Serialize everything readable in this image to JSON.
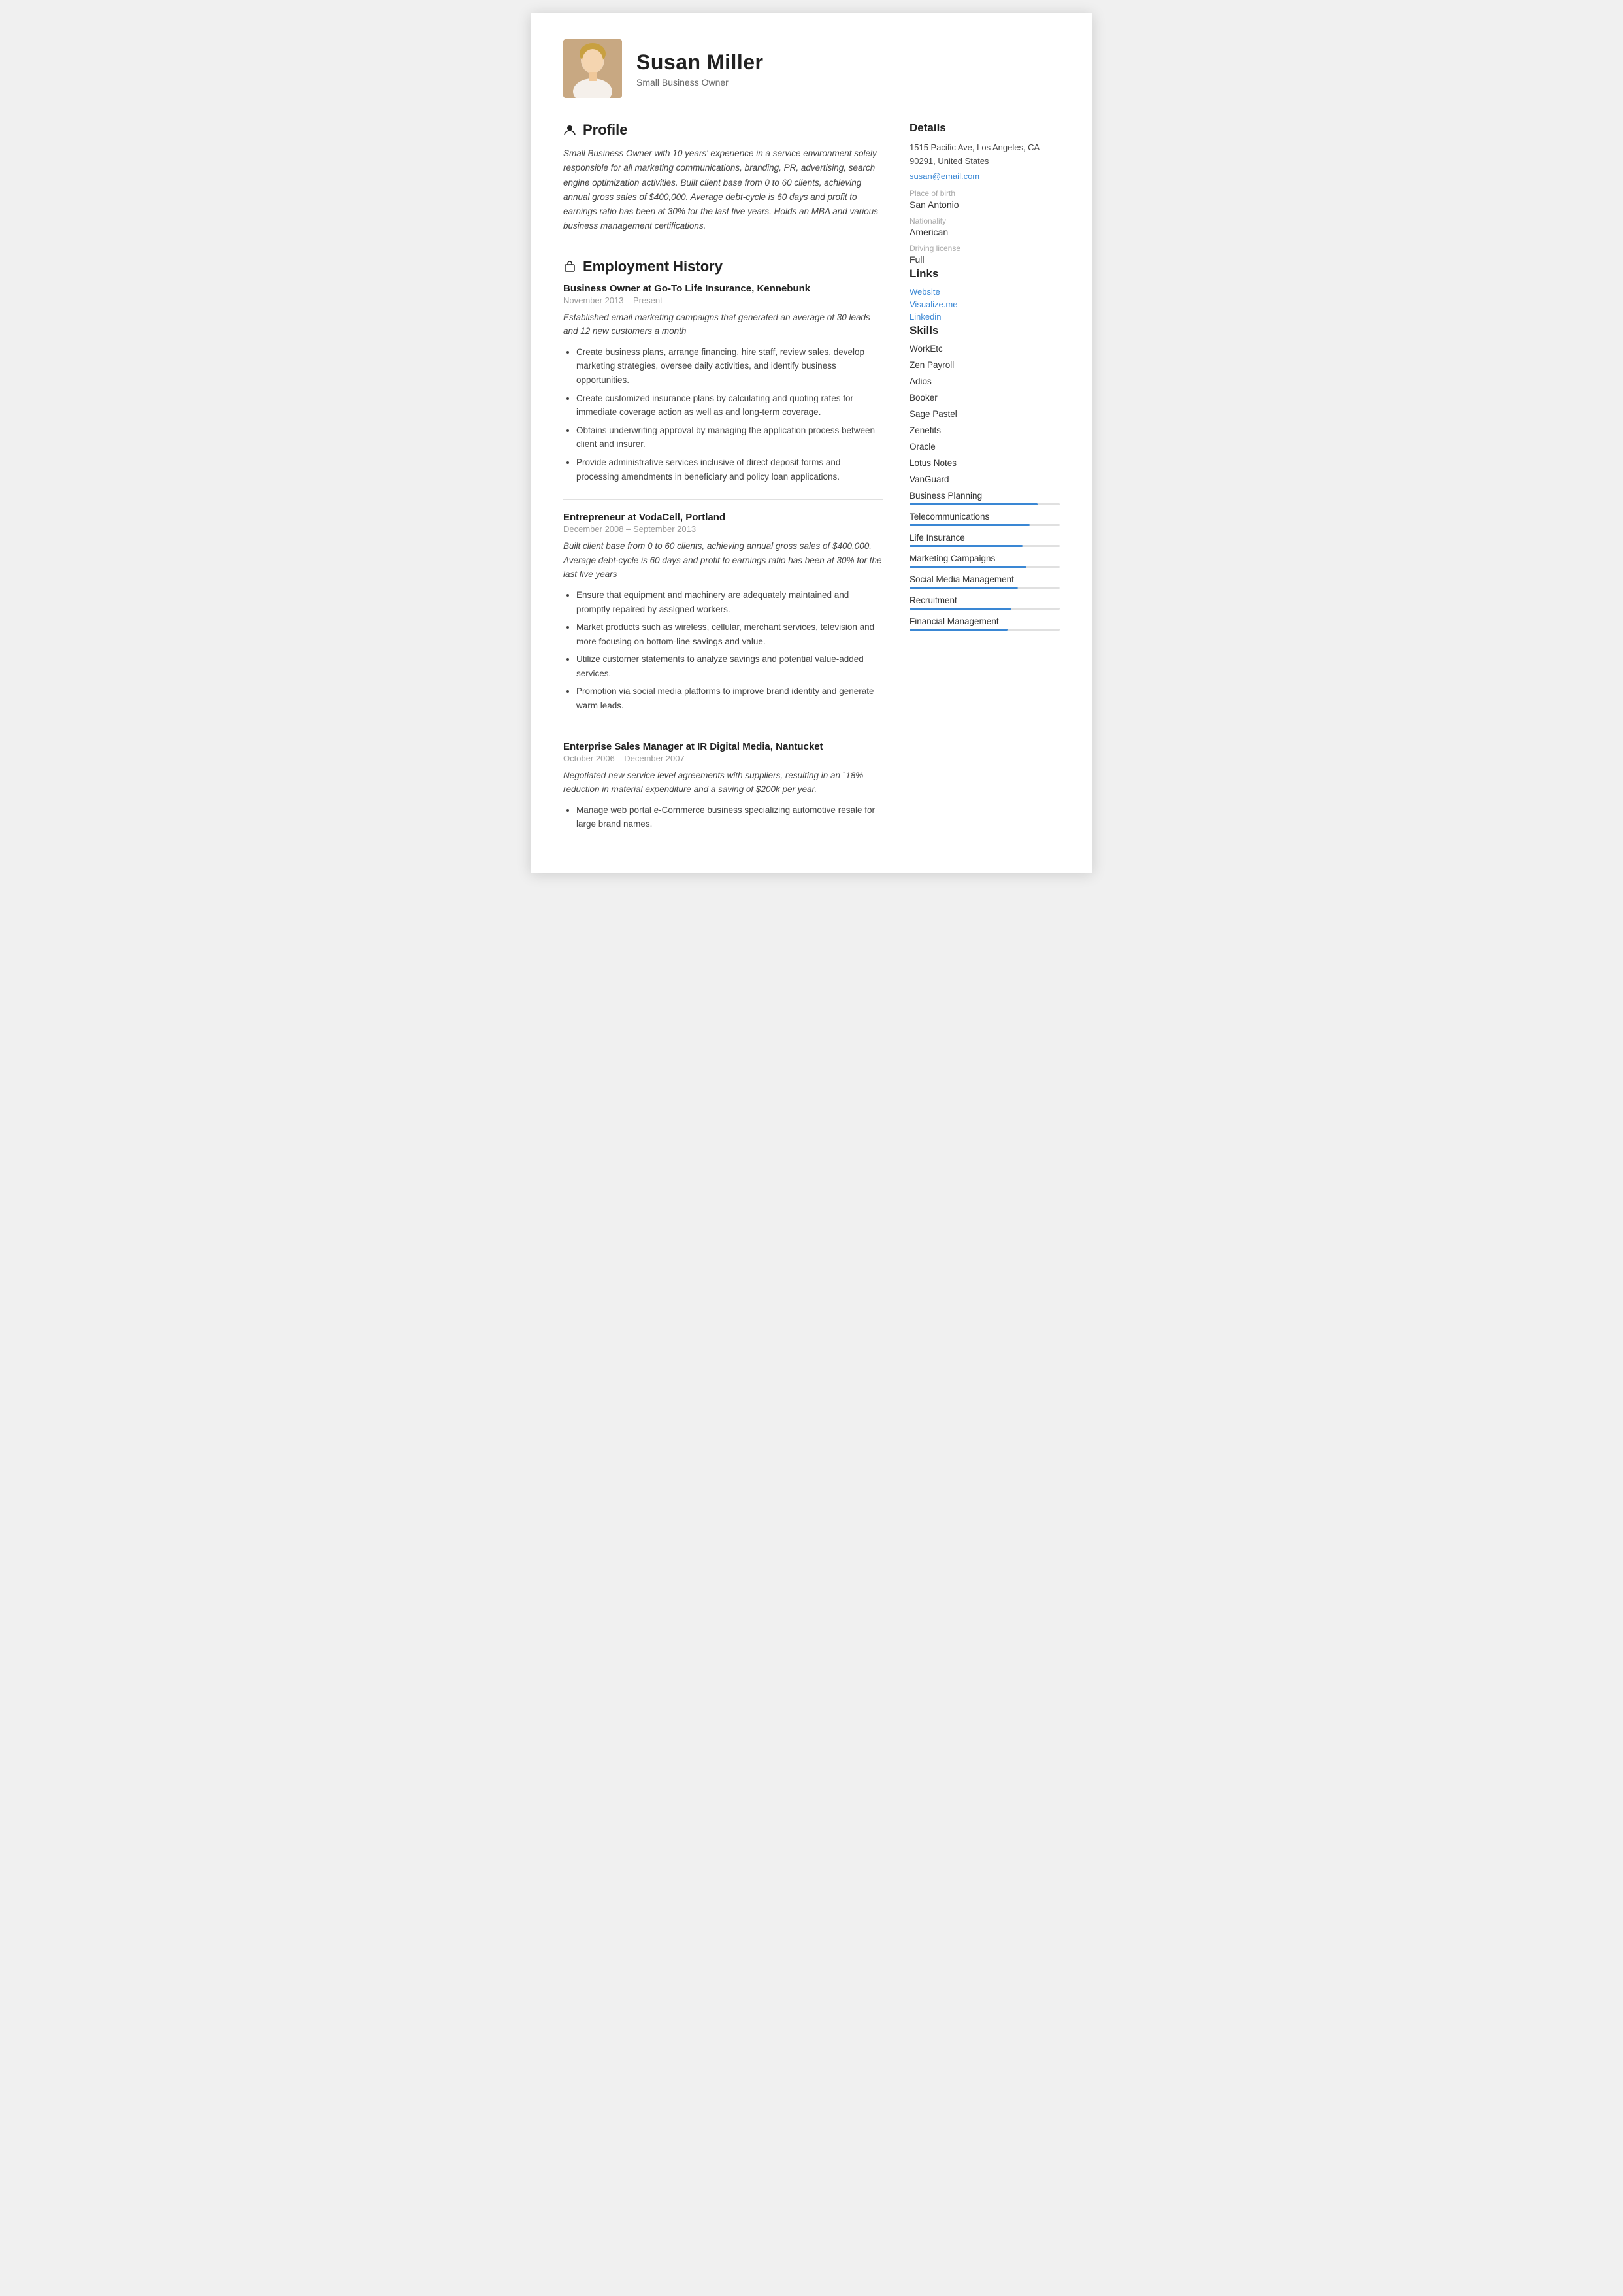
{
  "header": {
    "name": "Susan Miller",
    "subtitle": "Small Business Owner",
    "avatar_alt": "Susan Miller photo"
  },
  "profile": {
    "section_label": "Profile",
    "text": "Small Business Owner with 10 years' experience in a service environment solely responsible for all marketing communications, branding, PR, advertising, search engine optimization activities. Built client base from 0 to 60 clients, achieving annual gross sales of $400,000. Average debt-cycle is 60 days and profit to earnings ratio has been at 30% for the last five years. Holds an MBA and various business management certifications."
  },
  "employment": {
    "section_label": "Employment History",
    "jobs": [
      {
        "title": "Business Owner at Go-To Life Insurance, Kennebunk",
        "dates": "November 2013 – Present",
        "summary": "Established email marketing campaigns that generated an average of 30 leads and 12 new customers a month",
        "bullets": [
          "Create business plans, arrange financing, hire staff, review sales, develop marketing strategies, oversee daily activities, and identify business opportunities.",
          "Create customized insurance plans by calculating and quoting rates for immediate coverage action as well as and long-term coverage.",
          "Obtains underwriting approval by managing the application process between client and insurer.",
          "Provide administrative services inclusive of direct deposit forms and processing amendments in beneficiary and policy loan applications."
        ]
      },
      {
        "title": "Entrepreneur at VodaCell, Portland",
        "dates": "December 2008 – September 2013",
        "summary": "Built client base from 0 to 60 clients, achieving annual gross sales of $400,000. Average debt-cycle is 60 days and profit to earnings ratio has been at 30% for the last five years",
        "bullets": [
          "Ensure that equipment and machinery are adequately maintained and promptly repaired by assigned workers.",
          "Market products such as wireless, cellular, merchant services, television and more focusing on bottom-line savings and value.",
          "Utilize customer statements to analyze savings and potential value-added services.",
          "Promotion via social media platforms to improve brand identity and generate warm leads."
        ]
      },
      {
        "title": "Enterprise Sales Manager at IR Digital Media, Nantucket",
        "dates": "October 2006 – December 2007",
        "summary": "Negotiated new service level agreements with suppliers, resulting in an `18% reduction in material expenditure and a saving of $200k per year.",
        "bullets": [
          "Manage web portal e-Commerce business specializing automotive resale for large brand names."
        ]
      }
    ]
  },
  "details": {
    "section_label": "Details",
    "address": "1515 Pacific Ave, Los Angeles, CA 90291, United States",
    "email": "susan@email.com",
    "place_of_birth_label": "Place of birth",
    "place_of_birth": "San Antonio",
    "nationality_label": "Nationality",
    "nationality": "American",
    "driving_license_label": "Driving license",
    "driving_license": "Full"
  },
  "links": {
    "section_label": "Links",
    "items": [
      {
        "label": "Website"
      },
      {
        "label": "Visualize.me"
      },
      {
        "label": "Linkedin"
      }
    ]
  },
  "skills": {
    "section_label": "Skills",
    "items": [
      {
        "name": "WorkEtc",
        "has_bar": false
      },
      {
        "name": "Zen Payroll",
        "has_bar": false
      },
      {
        "name": "Adios",
        "has_bar": false
      },
      {
        "name": "Booker",
        "has_bar": false
      },
      {
        "name": "Sage Pastel",
        "has_bar": false
      },
      {
        "name": "Zenefits",
        "has_bar": false
      },
      {
        "name": "Oracle",
        "has_bar": false
      },
      {
        "name": "Lotus Notes",
        "has_bar": false
      },
      {
        "name": "VanGuard",
        "has_bar": false
      },
      {
        "name": "Business Planning",
        "has_bar": true,
        "fill": 85
      },
      {
        "name": "Telecommunications",
        "has_bar": true,
        "fill": 80
      },
      {
        "name": "Life Insurance",
        "has_bar": true,
        "fill": 75
      },
      {
        "name": "Marketing Campaigns",
        "has_bar": true,
        "fill": 78
      },
      {
        "name": "Social Media Management",
        "has_bar": true,
        "fill": 72
      },
      {
        "name": "Recruitment",
        "has_bar": true,
        "fill": 68
      },
      {
        "name": "Financial Management",
        "has_bar": true,
        "fill": 65
      }
    ]
  }
}
